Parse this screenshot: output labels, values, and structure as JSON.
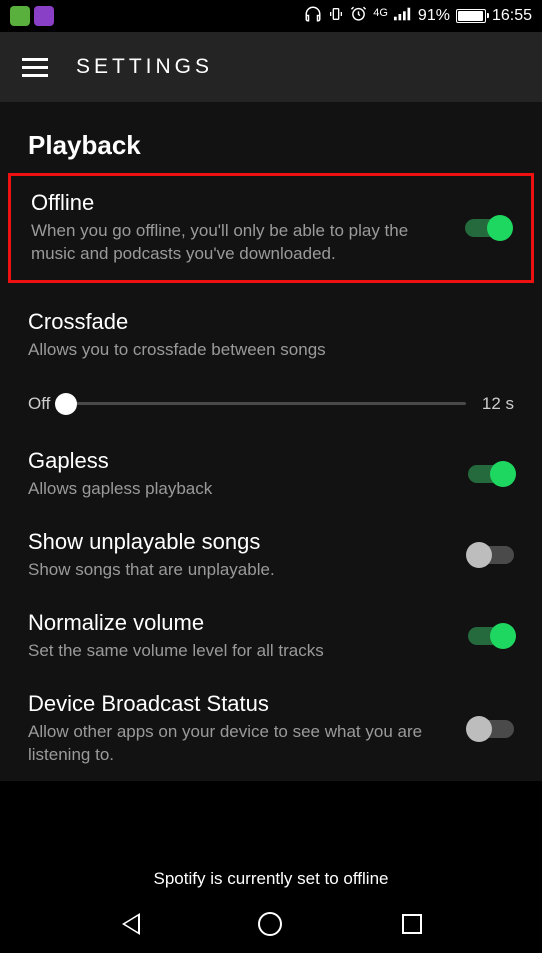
{
  "status": {
    "battery_pct": "91%",
    "time": "16:55",
    "net": "4G"
  },
  "header": {
    "title": "SETTINGS"
  },
  "section": {
    "title": "Playback"
  },
  "settings": {
    "offline": {
      "title": "Offline",
      "desc": "When you go offline, you'll only be able to play the music and podcasts you've downloaded.",
      "on": true
    },
    "crossfade": {
      "title": "Crossfade",
      "desc": "Allows you to crossfade between songs",
      "slider_left": "Off",
      "slider_right": "12 s"
    },
    "gapless": {
      "title": "Gapless",
      "desc": "Allows gapless playback",
      "on": true
    },
    "unplayable": {
      "title": "Show unplayable songs",
      "desc": "Show songs that are unplayable.",
      "on": false
    },
    "normalize": {
      "title": "Normalize volume",
      "desc": "Set the same volume level for all tracks",
      "on": true
    },
    "broadcast": {
      "title": "Device Broadcast Status",
      "desc": "Allow other apps on your device to see what you are listening to.",
      "on": false
    }
  },
  "toast": "Spotify is currently set to offline"
}
